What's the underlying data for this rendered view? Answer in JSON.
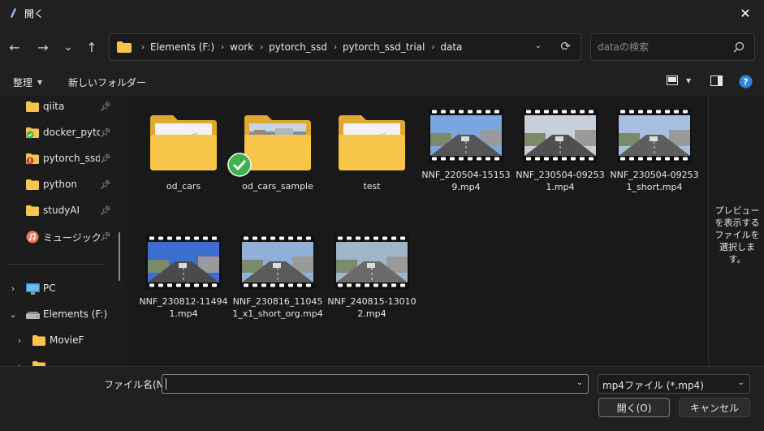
{
  "window": {
    "title": "開く",
    "close_glyph": "✕"
  },
  "nav": {
    "back_glyph": "←",
    "forward_glyph": "→",
    "recent_glyph": "⌄",
    "up_glyph": "↑",
    "breadcrumbs": [
      "Elements (F:)",
      "work",
      "pytorch_ssd",
      "pytorch_ssd_trial",
      "data"
    ],
    "search_placeholder": "dataの検索"
  },
  "toolbar": {
    "organize_label": "整理",
    "new_folder_label": "新しいフォルダー"
  },
  "sidebar": {
    "items": [
      {
        "label": "qiita",
        "icon": "folder-icon",
        "pinned": true,
        "overlay": ""
      },
      {
        "label": "docker_pytorch",
        "icon": "folder-icon",
        "pinned": true,
        "overlay": "sync-ok-icon"
      },
      {
        "label": "pytorch_ssd_",
        "icon": "folder-icon",
        "pinned": true,
        "overlay": "error-icon"
      },
      {
        "label": "python",
        "icon": "folder-icon",
        "pinned": true,
        "overlay": ""
      },
      {
        "label": "studyAI",
        "icon": "folder-icon",
        "pinned": true,
        "overlay": ""
      },
      {
        "label": "ミュージック",
        "icon": "music-icon",
        "pinned": true,
        "overlay": ""
      }
    ],
    "tree": [
      {
        "label": "PC",
        "icon": "pc-icon",
        "chevron": "›"
      },
      {
        "label": "Elements (F:)",
        "icon": "drive-icon",
        "chevron": "⌄"
      },
      {
        "label": "MovieF",
        "icon": "folder-icon",
        "chevron": "›"
      }
    ]
  },
  "files": [
    {
      "name": "od_cars",
      "kind": "folder"
    },
    {
      "name": "od_cars_sample",
      "kind": "folder-photo"
    },
    {
      "name": "test",
      "kind": "folder"
    },
    {
      "name": "NNF_220504-151539.mp4",
      "kind": "video"
    },
    {
      "name": "NNF_230504-092531.mp4",
      "kind": "video"
    },
    {
      "name": "NNF_230504-092531_short.mp4",
      "kind": "video"
    },
    {
      "name": "NNF_230812-114941.mp4",
      "kind": "video"
    },
    {
      "name": "NNF_230816_110451_x1_short_org.mp4",
      "kind": "video"
    },
    {
      "name": "NNF_240815-130102.mp4",
      "kind": "video"
    }
  ],
  "preview": {
    "message": "プレビューを表示するファイルを選択します。"
  },
  "bottom": {
    "filename_label": "ファイル名(N):",
    "filename_value": "",
    "filetype_value": "mp4ファイル (*.mp4)",
    "open_label": "開く(O)",
    "cancel_label": "キャンセル"
  },
  "colors": {
    "folder": "#f6c54a",
    "folder_dark": "#e0a82e",
    "accent": "#2b88d8",
    "check": "#3fb24f"
  }
}
